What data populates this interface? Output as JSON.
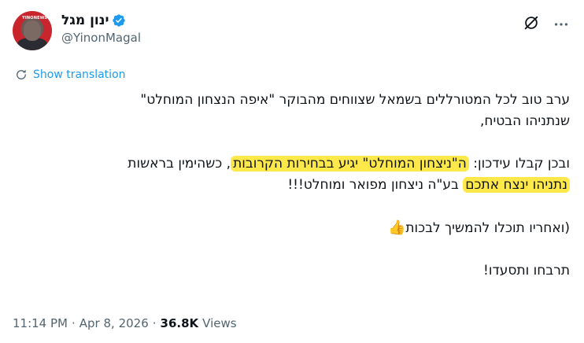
{
  "author": {
    "display_name": "ינון מגל",
    "handle": "@YinonMagal",
    "avatar_tag": "YINONEWS"
  },
  "translate": {
    "label": "Show translation"
  },
  "tweet": {
    "p1_line1": "ערב טוב לכל המטורללים בשמאל שצווחים מהבוקר \"איפה הנצחון המוחלט\"",
    "p1_line2": "שנתניהו הבטיח,",
    "p2_line1_pre": "ובכן קבלו עידכון: ",
    "p2_line1_hl": "ה\"ניצחון המוחלט\" יגיע בבחירות הקרובות",
    "p2_line1_post": ", כשהימין בראשות",
    "p2_line2_hl": "נתניהו ינצח אתכם",
    "p2_line2_post": " בע\"ה ניצחון מפואר ומוחלט!!!",
    "p3": "(ואחריו תוכלו להמשיך לבכות",
    "p3_emoji": "👍",
    "p4": "תרבחו ותסעדו!"
  },
  "meta": {
    "time": "11:14 PM",
    "sep1": "·",
    "date": "Apr 8, 2026",
    "sep2": "·",
    "views_count": "36.8K",
    "views_label": "Views"
  },
  "colors": {
    "accent": "#1d9bf0",
    "highlight": "#ffe94a",
    "text": "#0f1419",
    "muted": "#536471"
  },
  "icons": [
    "verified-badge-icon",
    "grok-icon",
    "more-icon",
    "translate-icon"
  ]
}
